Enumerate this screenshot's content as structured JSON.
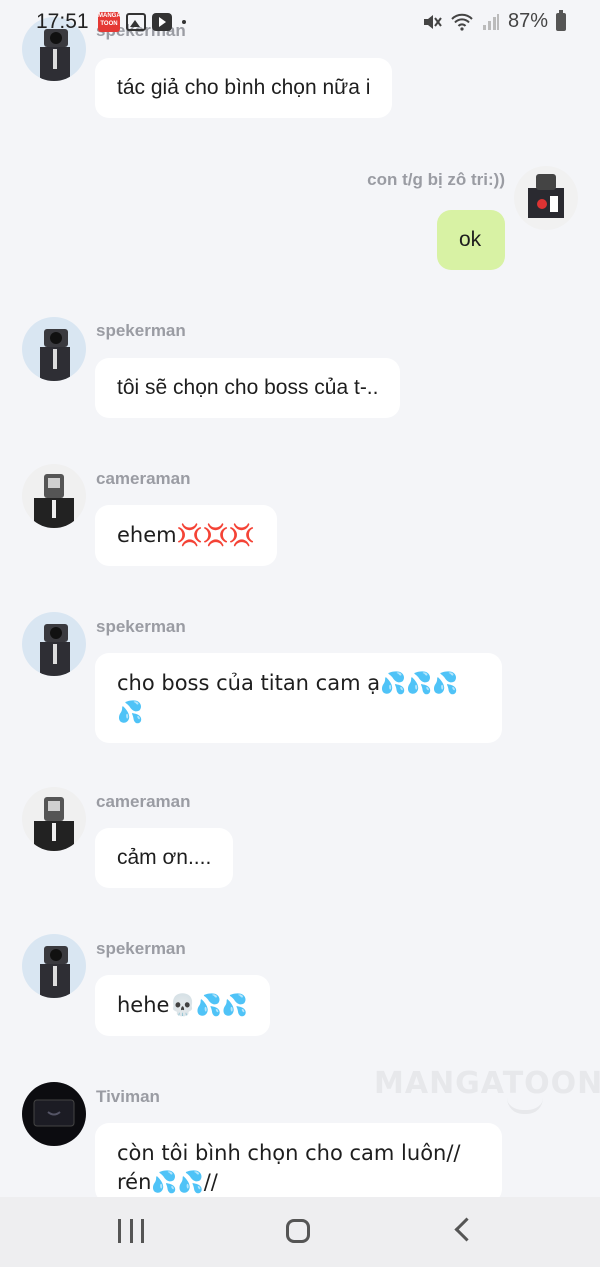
{
  "status_bar": {
    "time": "17:51",
    "battery": "87%",
    "mangatoon_icon_text": "MANGA TOON"
  },
  "messages": [
    {
      "sender": "spekerman",
      "text": "tác giả cho bình chọn nữa i",
      "side": "left"
    },
    {
      "sender": "con t/g bị zô tri:))",
      "text": "ok",
      "side": "right"
    },
    {
      "sender": "spekerman",
      "text": "tôi sẽ chọn cho boss của t-..",
      "side": "left"
    },
    {
      "sender": "cameraman",
      "text": "ehem💢💢💢",
      "side": "left"
    },
    {
      "sender": "spekerman",
      "text": "cho boss của titan cam ạ💦💦💦💦",
      "side": "left"
    },
    {
      "sender": "cameraman",
      "text": "cảm ơn....",
      "side": "left"
    },
    {
      "sender": "spekerman",
      "text": "hehe💀💦💦",
      "side": "left"
    },
    {
      "sender": "Tiviman",
      "text": "còn tôi bình chọn cho cam luôn// rén💦💦//",
      "side": "left"
    }
  ],
  "watermark": "MANGATOON",
  "colors": {
    "background": "#f4f5f8",
    "bubble_other": "#ffffff",
    "bubble_me": "#d8f2a4",
    "sender_name": "#9a9ca3"
  }
}
